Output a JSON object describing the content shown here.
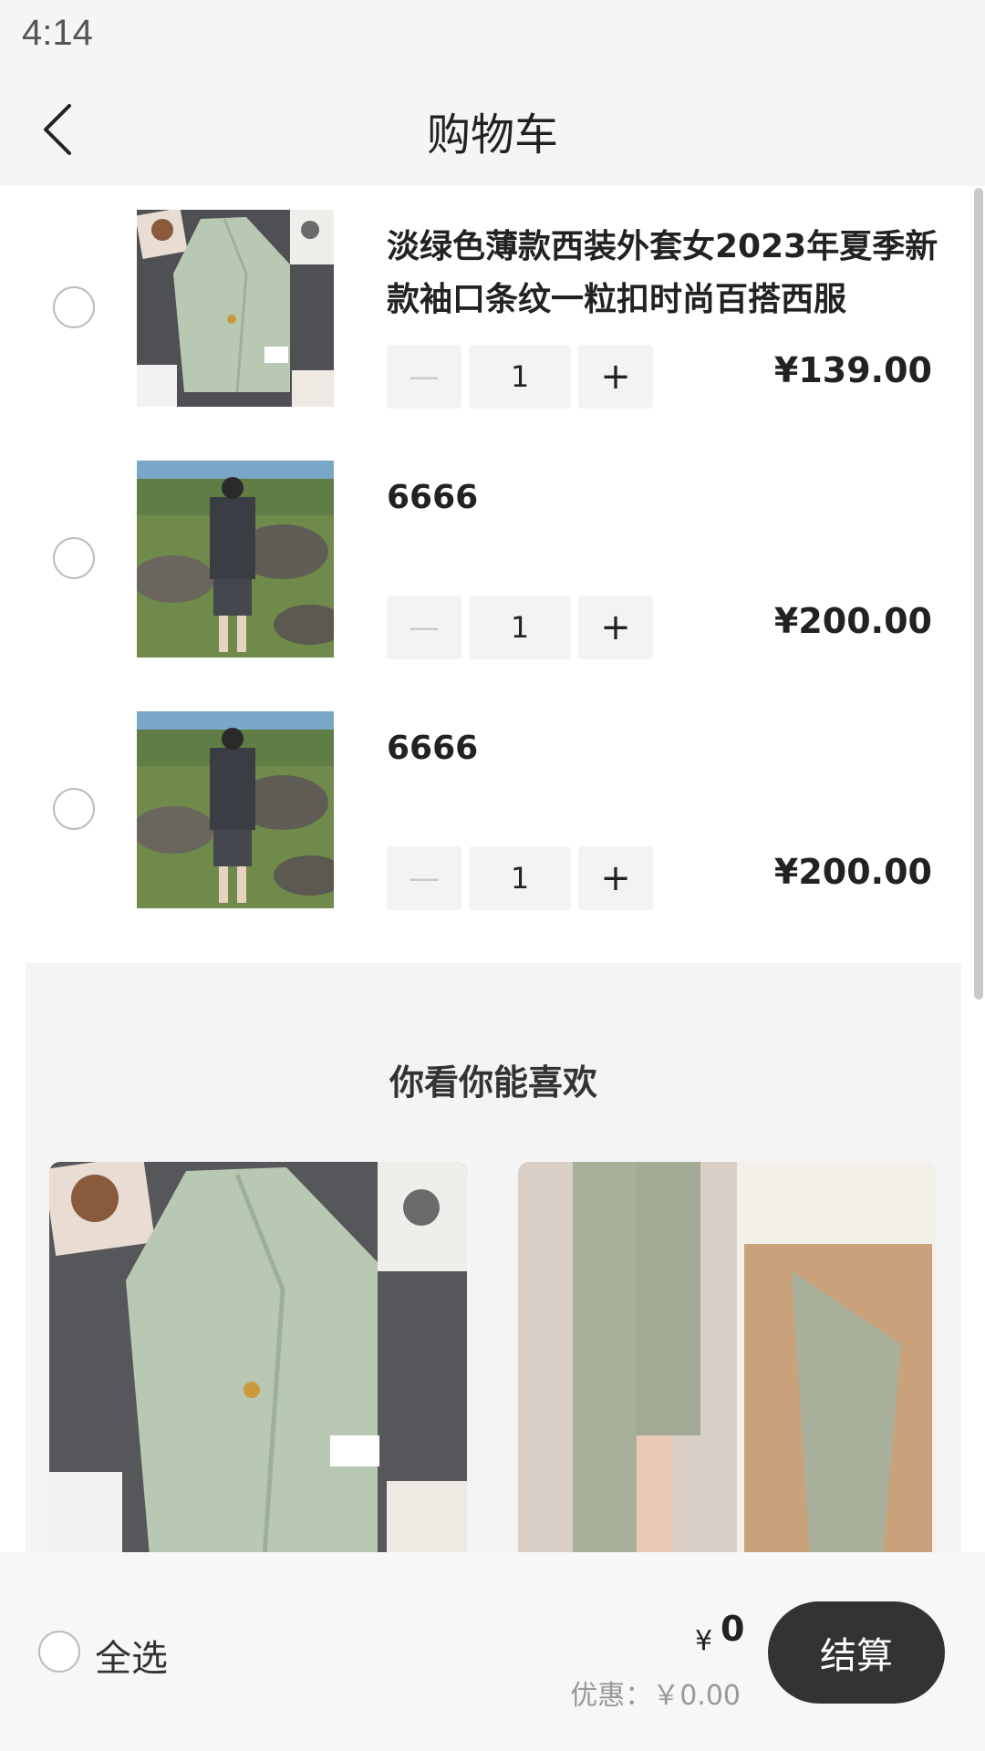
{
  "status_bar": {
    "time": "4:14"
  },
  "header": {
    "title": "购物车",
    "back_icon": "chevron-left-icon"
  },
  "cart": {
    "items": [
      {
        "title": "淡绿色薄款西装外套女2023年夏季新款袖口条纹一粒扣时尚百搭西服",
        "quantity": "1",
        "price": "¥139.00",
        "minus": "—",
        "plus": "+"
      },
      {
        "title": "6666",
        "quantity": "1",
        "price": "¥200.00",
        "minus": "—",
        "plus": "+"
      },
      {
        "title": "6666",
        "quantity": "1",
        "price": "¥200.00",
        "minus": "—",
        "plus": "+"
      }
    ]
  },
  "recommendations": {
    "title": "你看你能喜欢"
  },
  "bottom_bar": {
    "select_all_label": "全选",
    "currency": "¥",
    "total": "0",
    "discount": "优惠：￥0.00",
    "checkout_label": "结算"
  },
  "colors": {
    "background": "#f5f5f5",
    "checkout_button": "#333333",
    "price_text": "#222222"
  }
}
